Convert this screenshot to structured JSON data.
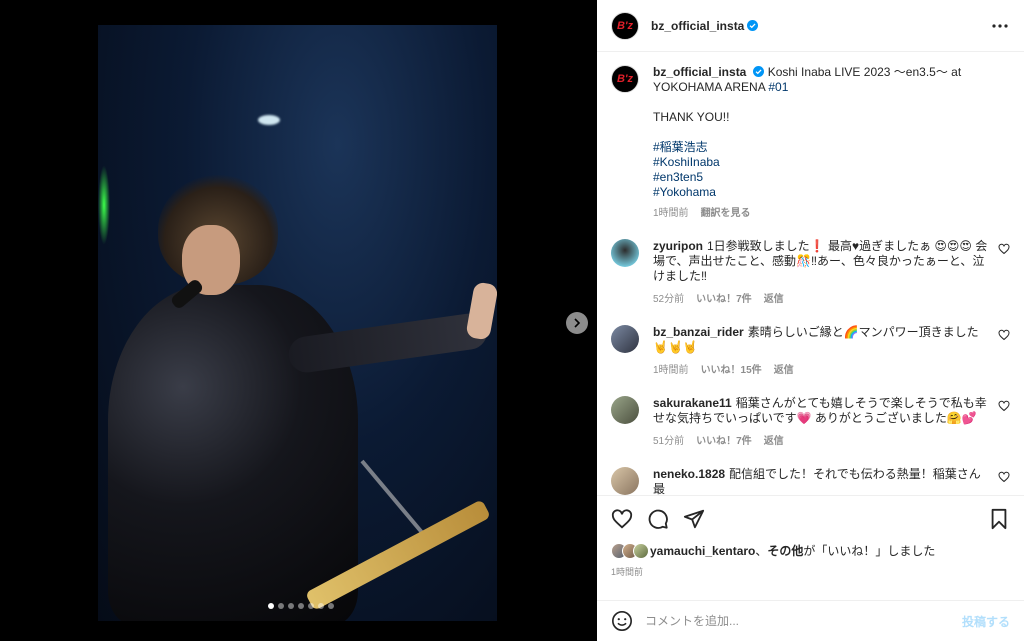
{
  "media": {
    "carousel_count": 7,
    "active_index": 0
  },
  "header": {
    "logo_text": "B'z",
    "username": "bz_official_insta"
  },
  "caption": {
    "username": "bz_official_insta",
    "text_line1": "Koshi Inaba LIVE 2023 〜en3.5〜 at YOKOHAMA ARENA ",
    "tag_01": "#01",
    "thanks": "THANK YOU!!",
    "tags": [
      "#稲葉浩志",
      "#KoshiInaba",
      "#en3ten5",
      "#Yokohama"
    ],
    "time": "1時間前",
    "see_translation": "翻訳を見る"
  },
  "comments": [
    {
      "username": "zyuripon",
      "text": "1日参戦致しました❗ 最高♥過ぎましたぁ 😍😍😍 会場で、声出せたこと、感動🎊‼あー、色々良かったぁーと、泣けました‼",
      "time": "52分前",
      "likes": "いいね！7件",
      "reply": "返信"
    },
    {
      "username": "bz_banzai_rider",
      "text": "素晴らしいご縁と🌈マンパワー頂きました 🤘🤘🤘",
      "time": "1時間前",
      "likes": "いいね！15件",
      "reply": "返信"
    },
    {
      "username": "sakurakane11",
      "text": "稲葉さんがとても嬉しそうで楽しそうで私も幸せな気持ちでいっぱいです💗 ありがとうございました🤗💕",
      "time": "51分前",
      "likes": "いいね！7件",
      "reply": "返信"
    },
    {
      "username": "neneko.1828",
      "text": "配信組でした！それでも伝わる熱量！稲葉さん最",
      "time": "",
      "likes": "",
      "reply": ""
    }
  ],
  "likes_summary": {
    "user": "yamauchi_kentaro",
    "sep": "、",
    "others": "その他",
    "suffix": "が「いいね！」しました"
  },
  "post_time": "1時間前",
  "composer": {
    "placeholder": "コメントを追加...",
    "post_label": "投稿する"
  },
  "colors": {
    "link": "#00376b",
    "verified": "#0095f6",
    "post_disabled": "#b2dffc"
  }
}
